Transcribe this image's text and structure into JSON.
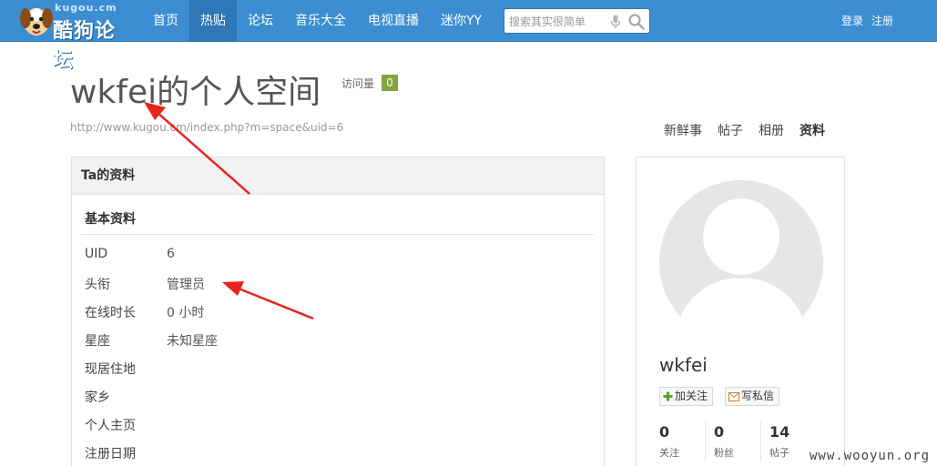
{
  "logo": {
    "site": "kugou.cm",
    "brand": "酷狗论坛"
  },
  "nav": {
    "items": [
      {
        "label": "首页"
      },
      {
        "label": "热贴"
      },
      {
        "label": "论坛"
      },
      {
        "label": "音乐大全"
      },
      {
        "label": "电视直播"
      },
      {
        "label": "迷你YY"
      }
    ],
    "active_index": 1
  },
  "search": {
    "placeholder": "搜索其实很简单"
  },
  "auth": {
    "login": "登录",
    "register": "注册"
  },
  "header": {
    "title": "wkfei的个人空间",
    "visits_label": "访问量",
    "visits_count": "0",
    "url": "http://www.kugou.cm/index.php?m=space&uid=6"
  },
  "tabs": [
    {
      "label": "新鲜事"
    },
    {
      "label": "帖子"
    },
    {
      "label": "相册"
    },
    {
      "label": "资料"
    }
  ],
  "active_tab": 3,
  "profile": {
    "panel_title": "Ta的资料",
    "section_title": "基本资料",
    "rows": [
      {
        "key": "UID",
        "value": "6"
      },
      {
        "key": "头衔",
        "value": "管理员"
      },
      {
        "key": "在线时长",
        "value": "0 小时"
      },
      {
        "key": "星座",
        "value": "未知星座"
      },
      {
        "key": "现居住地",
        "value": ""
      },
      {
        "key": "家乡",
        "value": ""
      },
      {
        "key": "个人主页",
        "value": ""
      },
      {
        "key": "注册日期",
        "value": ""
      }
    ]
  },
  "card": {
    "name": "wkfei",
    "follow_label": "加关注",
    "message_label": "写私信",
    "stats": [
      {
        "value": "0",
        "label": "关注"
      },
      {
        "value": "0",
        "label": "粉丝"
      },
      {
        "value": "14",
        "label": "帖子"
      }
    ]
  },
  "watermark": "www.wooyun.org",
  "colors": {
    "nav_bar": "#3c8dd1",
    "nav_active": "#2f77b6",
    "badge": "#80a53b",
    "annotation_arrow": "#e8231e"
  },
  "icons": [
    "dog-logo-icon",
    "microphone-icon",
    "search-icon",
    "add-icon",
    "envelope-icon",
    "avatar-placeholder-icon"
  ]
}
